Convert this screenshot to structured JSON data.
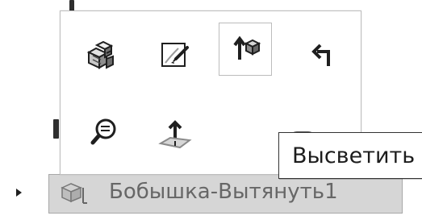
{
  "toolbar": {
    "buttons": [
      {
        "name": "part-dependencies",
        "icon": "parts-box-icon",
        "highlighted": false
      },
      {
        "name": "edit-sketch",
        "icon": "sketch-edit-icon",
        "highlighted": false
      },
      {
        "name": "normal-to",
        "icon": "normal-to-icon",
        "highlighted": true
      },
      {
        "name": "rollback",
        "icon": "rollback-arrow-icon",
        "highlighted": false
      },
      {
        "name": "zoom-to-selection",
        "icon": "zoom-selection-icon",
        "highlighted": false
      },
      {
        "name": "extrude-direction",
        "icon": "extrude-direction-icon",
        "highlighted": false
      },
      {
        "name": "highlight",
        "icon": "highlight-icon",
        "highlighted": false
      }
    ]
  },
  "tooltip": {
    "text": "Высветить"
  },
  "tree": {
    "selected_item_label": "Бобышка-Вытянуть1",
    "expander_icon": "triangle-right-icon"
  },
  "colors": {
    "tooltip_border": "#333333",
    "popup_border": "#bdbdbd",
    "selected_row_bg": "#d6d6d6",
    "selected_row_border": "#a8a8a8",
    "icon_dark": "#1f1f1f"
  }
}
